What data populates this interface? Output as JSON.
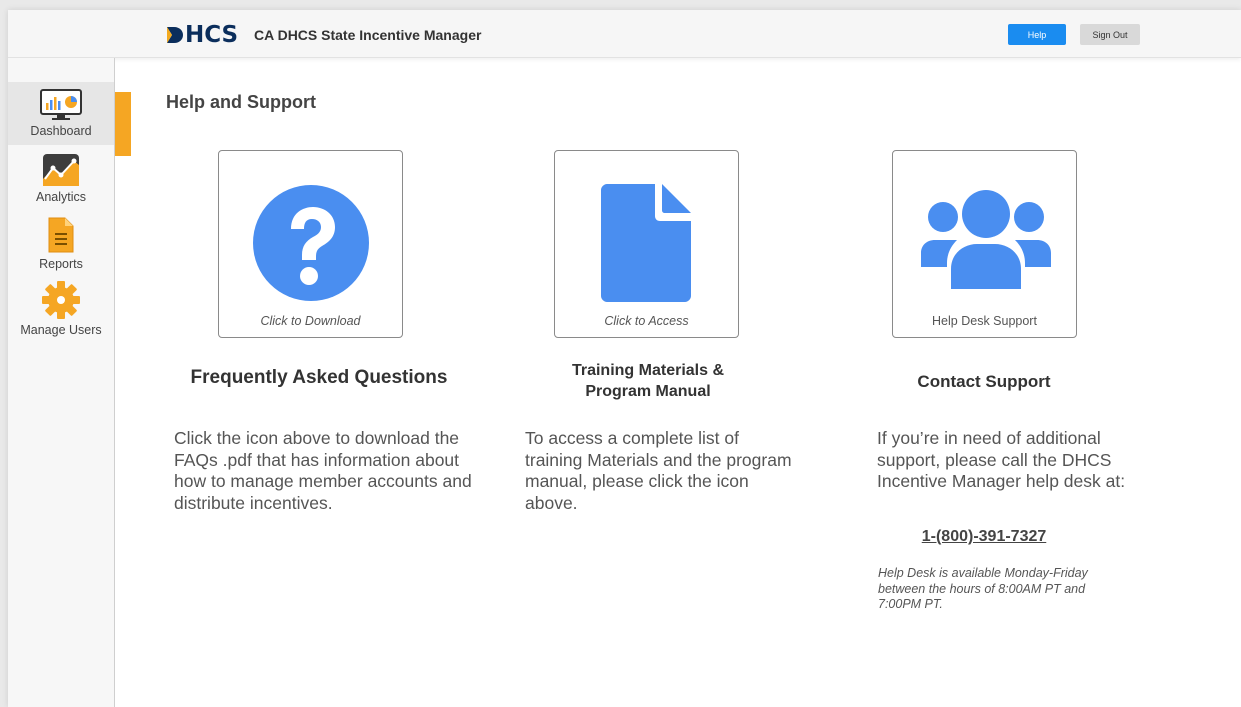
{
  "header": {
    "logo_text": "HCS",
    "app_title": "CA DHCS State Incentive Manager",
    "help_label": "Help",
    "signout_label": "Sign Out"
  },
  "sidebar": {
    "items": [
      {
        "label": "Dashboard",
        "icon": "dashboard-monitor-icon",
        "active": true
      },
      {
        "label": "Analytics",
        "icon": "analytics-chart-icon",
        "active": false
      },
      {
        "label": "Reports",
        "icon": "report-document-icon",
        "active": false
      },
      {
        "label": "Manage Users",
        "icon": "gear-icon",
        "active": false
      }
    ]
  },
  "main": {
    "title": "Help and Support",
    "cards": [
      {
        "caption": "Click to Download",
        "icon": "question-circle-icon",
        "title": "Frequently Asked Questions",
        "description": "Click the icon above to download the FAQs .pdf that has information about how to manage member accounts and distribute incentives."
      },
      {
        "caption": "Click to Access",
        "icon": "document-icon",
        "title": "Training Materials & Program Manual",
        "description": "To access a complete list of training Materials and the program manual, please click the icon above."
      },
      {
        "caption": "Help Desk Support",
        "icon": "users-group-icon",
        "title": "Contact Support",
        "description": "If you’re in need of additional support, please call the DHCS Incentive Manager help desk at:",
        "phone": "1-(800)-391-7327",
        "hours": "Help Desk is available Monday-Friday between the hours of 8:00AM PT and 7:00PM PT."
      }
    ]
  },
  "colors": {
    "accent_blue": "#4a8ef0",
    "help_button": "#1a8cf0",
    "active_marker": "#f5a623",
    "logo_navy": "#0b2e5c"
  }
}
